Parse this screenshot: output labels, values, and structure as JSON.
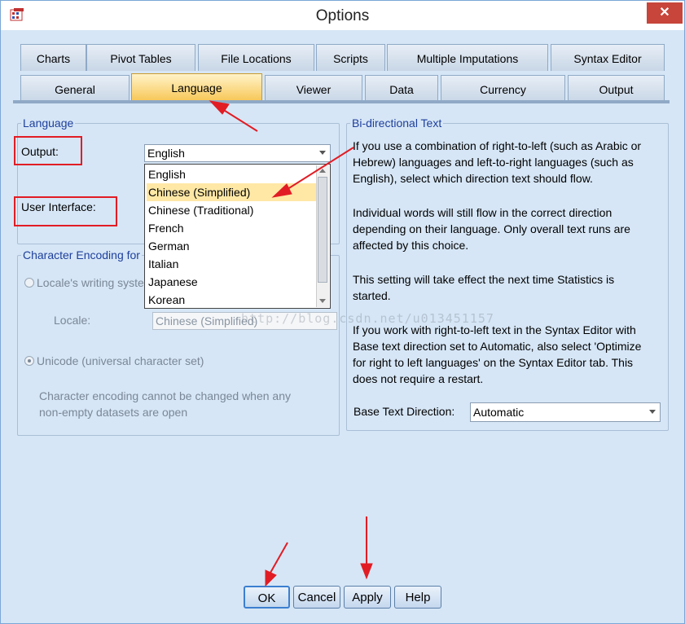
{
  "window": {
    "title": "Options",
    "close_glyph": "✕"
  },
  "tabs_row1": [
    "Charts",
    "Pivot Tables",
    "File Locations",
    "Scripts",
    "Multiple Imputations",
    "Syntax Editor"
  ],
  "tabs_row2": [
    "General",
    "Language",
    "Viewer",
    "Data",
    "Currency",
    "Output"
  ],
  "language": {
    "legend": "Language",
    "output_label": "Output:",
    "output_value": "English",
    "ui_label": "User Interface:",
    "options": [
      "English",
      "Chinese (Simplified)",
      "Chinese (Traditional)",
      "French",
      "German",
      "Italian",
      "Japanese",
      "Korean"
    ],
    "selected_option": "Chinese (Simplified)"
  },
  "encoding": {
    "legend": "Character Encoding for",
    "locale_radio": "Locale's writing syste",
    "locale_label": "Locale:",
    "locale_value": "Chinese (Simplified)",
    "unicode_radio": "Unicode (universal character set)",
    "note_line1": "Character encoding cannot be changed when any",
    "note_line2": "non-empty datasets are open"
  },
  "bidi": {
    "legend": "Bi-directional Text",
    "p1": [
      "If you use a combination of right-to-left (such as Arabic or",
      "Hebrew) languages and left-to-right languages (such as",
      "English), select which direction text should flow."
    ],
    "p2": [
      "Individual words will still flow in the correct direction",
      "depending on their language. Only overall text runs are",
      "affected by this choice."
    ],
    "p3": [
      "This setting will take effect the next time Statistics is",
      "started."
    ],
    "p4": [
      "If you work with right-to-left text in the Syntax Editor with",
      "Base text direction set to Automatic, also select 'Optimize",
      "for right to left languages' on the Syntax Editor tab. This",
      "does not require a restart."
    ],
    "base_label": "Base Text Direction:",
    "base_value": "Automatic"
  },
  "buttons": {
    "ok": "OK",
    "cancel": "Cancel",
    "apply": "Apply",
    "help": "Help"
  },
  "watermark": "http://blog.csdn.net/u013451157",
  "colors": {
    "annotation_red": "#e21c24",
    "selected_tab": "#f7c450",
    "selected_item": "#ffe8a6"
  }
}
